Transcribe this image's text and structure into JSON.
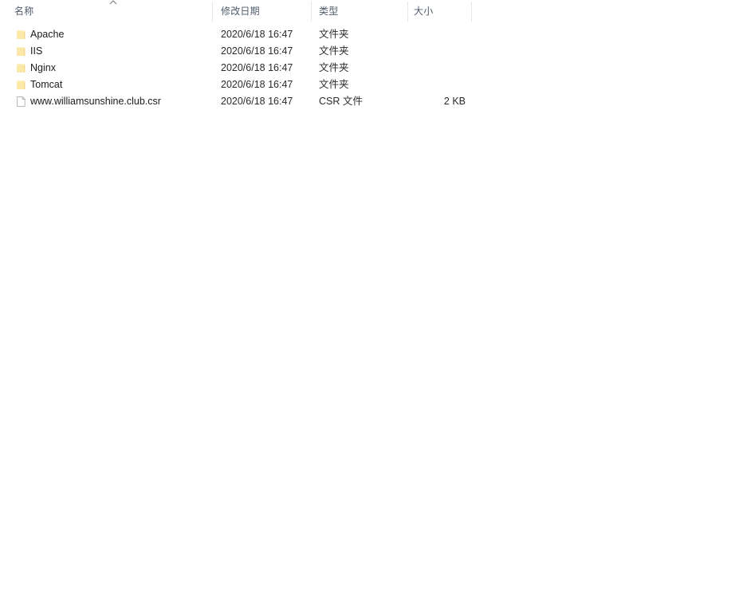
{
  "file_list": {
    "columns": [
      {
        "key": "name",
        "label": "名称",
        "icon": "sort-ascending-icon",
        "sorted": "ascending"
      },
      {
        "key": "date",
        "label": "修改日期",
        "icon": null,
        "sorted": null
      },
      {
        "key": "type",
        "label": "类型",
        "icon": null,
        "sorted": null
      },
      {
        "key": "size",
        "label": "大小",
        "icon": null,
        "sorted": null
      }
    ],
    "rows": [
      {
        "icon": "folder-icon",
        "name": "Apache",
        "date": "2020/6/18 16:47",
        "type": "文件夹",
        "size": ""
      },
      {
        "icon": "folder-icon",
        "name": "IIS",
        "date": "2020/6/18 16:47",
        "type": "文件夹",
        "size": ""
      },
      {
        "icon": "folder-icon",
        "name": "Nginx",
        "date": "2020/6/18 16:47",
        "type": "文件夹",
        "size": ""
      },
      {
        "icon": "folder-icon",
        "name": "Tomcat",
        "date": "2020/6/18 16:47",
        "type": "文件夹",
        "size": ""
      },
      {
        "icon": "document-icon",
        "name": "www.williamsunshine.club.csr",
        "date": "2020/6/18 16:47",
        "type": "CSR 文件",
        "size": "2 KB"
      }
    ]
  },
  "colors": {
    "background": "#ffffff",
    "header_text": "#4f5b6b",
    "row_text": "#1b1b1b",
    "divider": "#e6e6e6",
    "folder_yellow": "#fce9a7",
    "folder_edge": "#f2d98a",
    "document_outline": "#b9b9b9"
  }
}
